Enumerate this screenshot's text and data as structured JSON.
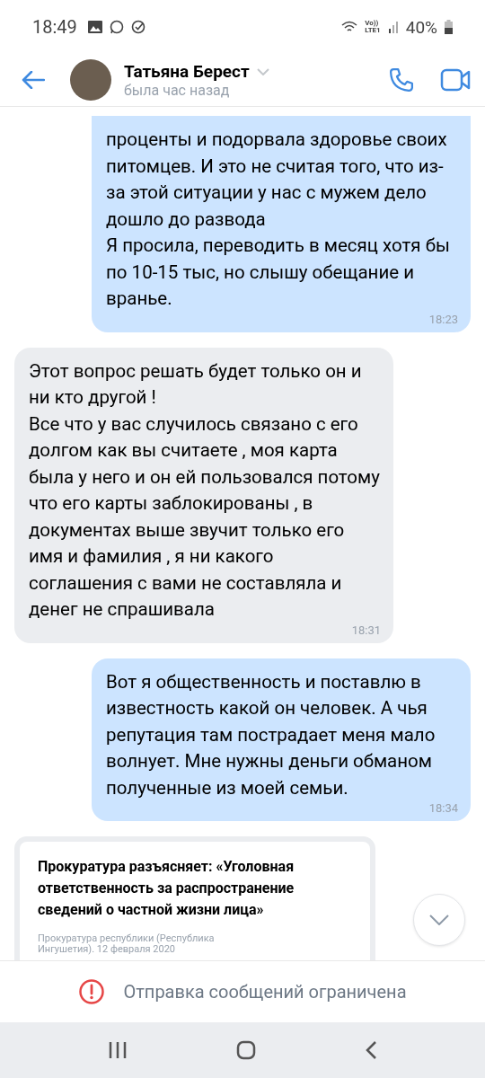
{
  "status_bar": {
    "time": "18:49",
    "network": "Vo))\nLTE1",
    "battery": "40%"
  },
  "header": {
    "name": "Татьяна Берест",
    "status": "была час назад"
  },
  "messages": [
    {
      "kind": "outgoing",
      "text": "проценты и подорвала здоровье своих питомцев. И это не считая того, что из-за этой ситуации у нас с мужем дело дошло до развода\nЯ просила, переводить в месяц хотя бы по 10-15 тыс, но слышу обещание и вранье.",
      "time": "18:23"
    },
    {
      "kind": "incoming",
      "text": "Этот вопрос решать будет только он и ни кто другой !\nВсе что у вас случилось связано с его долгом как вы считаете  , моя карта была у него и он ей пользовался потому что его карты заблокированы , в документах выше звучит только его имя и фамилия , я ни какого соглашения с вами не составляла и денег не спрашивала",
      "time": "18:31"
    },
    {
      "kind": "outgoing",
      "text": "Вот я общественность и поставлю в известность какой он человек. А чья репутация там пострадает меня мало волнует. Мне нужны деньги обманом полученные из моей семьи.",
      "time": "18:34"
    },
    {
      "kind": "link",
      "title": "Прокуратура разъясняет: «Уголовная ответственность за распространение сведений о частной жизни лица»",
      "source": "Прокуратура республики (Республика Ингушетия). 12 февраля 2020"
    }
  ],
  "restriction": "Отправка сообщений ограничена"
}
